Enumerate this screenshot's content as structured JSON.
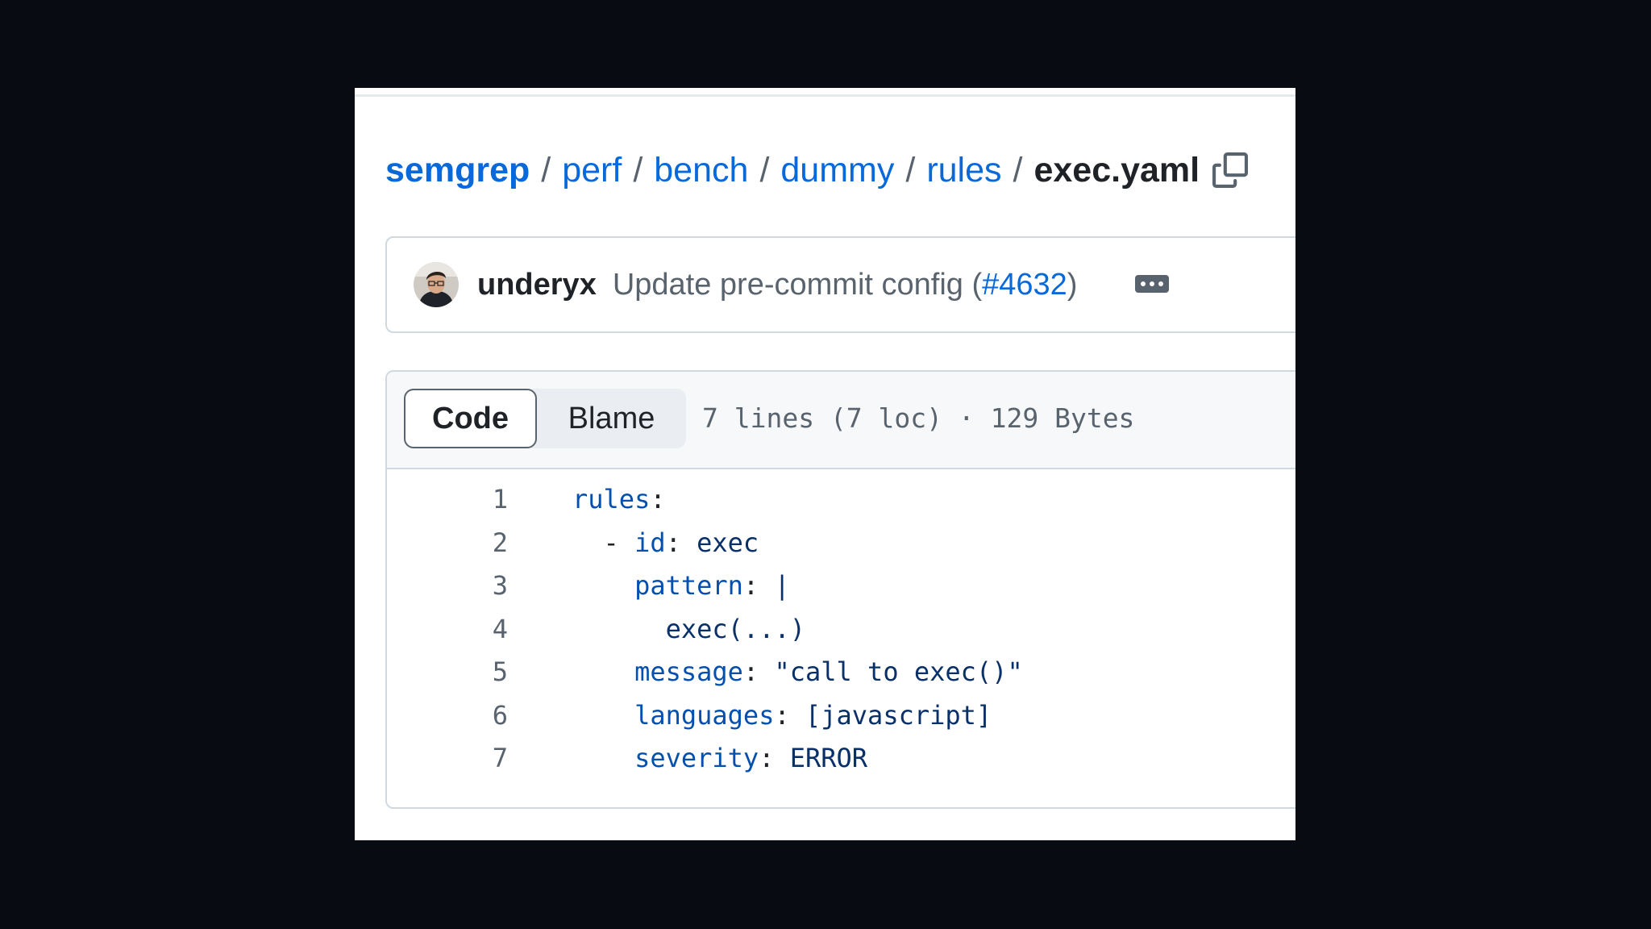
{
  "breadcrumb": {
    "repo": "semgrep",
    "folders": [
      "perf",
      "bench",
      "dummy",
      "rules"
    ],
    "separator": "/",
    "file": "exec.yaml",
    "copy_icon": "copy-icon"
  },
  "commit": {
    "author": "underyx",
    "message": "Update pre-commit config (",
    "pr": "#4632",
    "message_suffix": ")",
    "more_icon": "ellipsis-icon"
  },
  "file_header": {
    "tabs": [
      {
        "label": "Code",
        "active": true
      },
      {
        "label": "Blame",
        "active": false
      }
    ],
    "meta": "7 lines (7 loc) · 129 Bytes"
  },
  "code": {
    "lines": [
      {
        "num": "1",
        "indent": "",
        "key": "rules",
        "sep": ":",
        "value": ""
      },
      {
        "num": "2",
        "indent": "  ",
        "dash": "- ",
        "key": "id",
        "sep": ": ",
        "value": "exec"
      },
      {
        "num": "3",
        "indent": "    ",
        "key": "pattern",
        "sep": ": ",
        "value": "|"
      },
      {
        "num": "4",
        "indent": "      ",
        "key": "",
        "sep": "",
        "value": "exec(...)"
      },
      {
        "num": "5",
        "indent": "    ",
        "key": "message",
        "sep": ": ",
        "value": "\"call to exec()\""
      },
      {
        "num": "6",
        "indent": "    ",
        "key": "languages",
        "sep": ": ",
        "value": "[javascript]"
      },
      {
        "num": "7",
        "indent": "    ",
        "key": "severity",
        "sep": ": ",
        "value": "ERROR"
      }
    ]
  },
  "colors": {
    "link": "#0969da",
    "yaml_key": "#0550ae",
    "yaml_value": "#0a3069",
    "muted": "#59636e",
    "background": "#080c12"
  }
}
